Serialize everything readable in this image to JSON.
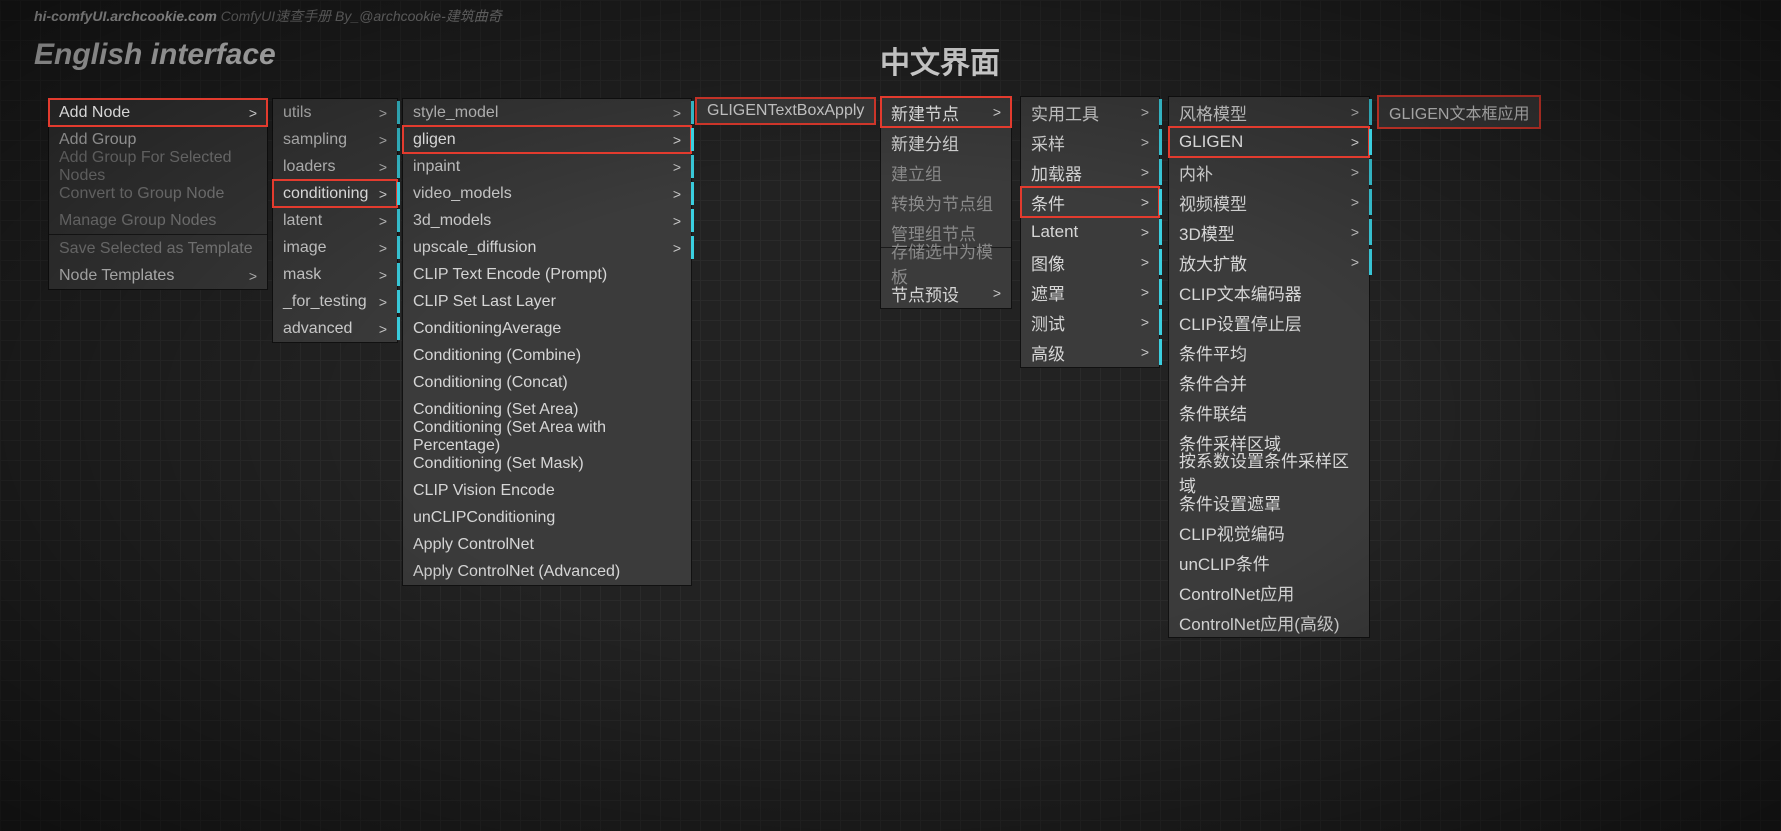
{
  "site": {
    "url": "hi-comfyUI.archcookie.com",
    "sub": "ComfyUI速查手册 By_@archcookie-建筑曲奇"
  },
  "titles": {
    "en": "English interface",
    "cn": "中文界面"
  },
  "en": {
    "m1": [
      {
        "l": "Add Node",
        "a": true,
        "red": true
      },
      {
        "l": "Add Group"
      },
      {
        "l": "Add Group For Selected Nodes",
        "dim": true
      },
      {
        "l": "Convert to Group Node",
        "dim": true
      },
      {
        "l": "Manage Group Nodes",
        "dim": true
      },
      {
        "sep": true
      },
      {
        "l": "Save Selected as Template",
        "dim": true
      },
      {
        "l": "Node Templates",
        "a": true
      }
    ],
    "m2": [
      {
        "l": "utils",
        "a": true,
        "teal": true
      },
      {
        "l": "sampling",
        "a": true,
        "teal": true
      },
      {
        "l": "loaders",
        "a": true,
        "teal": true
      },
      {
        "l": "conditioning",
        "a": true,
        "teal": true,
        "red": true
      },
      {
        "l": "latent",
        "a": true,
        "teal": true
      },
      {
        "l": "image",
        "a": true,
        "teal": true
      },
      {
        "l": "mask",
        "a": true,
        "teal": true
      },
      {
        "l": "_for_testing",
        "a": true,
        "teal": true
      },
      {
        "l": "advanced",
        "a": true,
        "teal": true
      }
    ],
    "m3": [
      {
        "l": "style_model",
        "a": true,
        "teal": true
      },
      {
        "l": "gligen",
        "a": true,
        "teal": true,
        "red": true
      },
      {
        "l": "inpaint",
        "a": true,
        "teal": true
      },
      {
        "l": "video_models",
        "a": true,
        "teal": true
      },
      {
        "l": "3d_models",
        "a": true,
        "teal": true
      },
      {
        "l": "upscale_diffusion",
        "a": true,
        "teal": true
      },
      {
        "l": "CLIP Text Encode (Prompt)"
      },
      {
        "l": "CLIP Set Last Layer"
      },
      {
        "l": "ConditioningAverage"
      },
      {
        "l": "Conditioning (Combine)"
      },
      {
        "l": "Conditioning (Concat)"
      },
      {
        "l": "Conditioning (Set Area)"
      },
      {
        "l": "Conditioning (Set Area with Percentage)"
      },
      {
        "l": "Conditioning (Set Mask)"
      },
      {
        "l": "CLIP Vision Encode"
      },
      {
        "l": "unCLIPConditioning"
      },
      {
        "l": "Apply ControlNet"
      },
      {
        "l": "Apply ControlNet (Advanced)"
      }
    ],
    "term": "GLIGENTextBoxApply"
  },
  "cn": {
    "m1": [
      {
        "l": "新建节点",
        "a": true,
        "red": true
      },
      {
        "l": "新建分组"
      },
      {
        "l": "建立组",
        "dim": true
      },
      {
        "l": "转换为节点组",
        "dim": true
      },
      {
        "l": "管理组节点",
        "dim": true
      },
      {
        "sep": true
      },
      {
        "l": "存储选中为模板",
        "dim": true
      },
      {
        "l": "节点预设",
        "a": true
      }
    ],
    "m2": [
      {
        "l": "实用工具",
        "a": true,
        "teal": true
      },
      {
        "l": "采样",
        "a": true,
        "teal": true
      },
      {
        "l": "加载器",
        "a": true,
        "teal": true
      },
      {
        "l": "条件",
        "a": true,
        "teal": true,
        "red": true
      },
      {
        "l": "Latent",
        "a": true,
        "teal": true
      },
      {
        "l": "图像",
        "a": true,
        "teal": true
      },
      {
        "l": "遮罩",
        "a": true,
        "teal": true
      },
      {
        "l": "测试",
        "a": true,
        "teal": true
      },
      {
        "l": "高级",
        "a": true,
        "teal": true
      }
    ],
    "m3": [
      {
        "l": "风格模型",
        "a": true,
        "teal": true
      },
      {
        "l": "GLIGEN",
        "a": true,
        "teal": true,
        "red": true
      },
      {
        "l": "内补",
        "a": true,
        "teal": true
      },
      {
        "l": "视频模型",
        "a": true,
        "teal": true
      },
      {
        "l": "3D模型",
        "a": true,
        "teal": true
      },
      {
        "l": "放大扩散",
        "a": true,
        "teal": true
      },
      {
        "l": "CLIP文本编码器"
      },
      {
        "l": "CLIP设置停止层"
      },
      {
        "l": "条件平均"
      },
      {
        "l": "条件合并"
      },
      {
        "l": "条件联结"
      },
      {
        "l": "条件采样区域"
      },
      {
        "l": "按系数设置条件采样区域"
      },
      {
        "l": "条件设置遮罩"
      },
      {
        "l": "CLIP视觉编码"
      },
      {
        "l": "unCLIP条件"
      },
      {
        "l": "ControlNet应用"
      },
      {
        "l": "ControlNet应用(高级)"
      }
    ],
    "term": "GLIGEN文本框应用"
  }
}
